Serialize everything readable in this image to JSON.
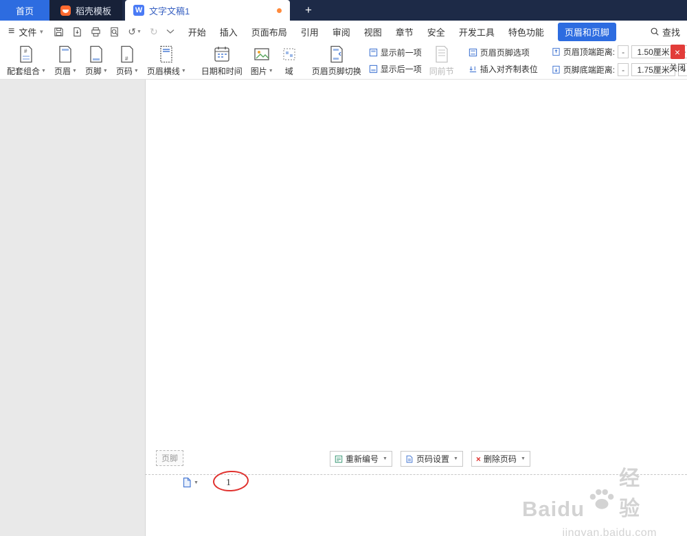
{
  "tabbar": {
    "home": "首页",
    "docer": "稻壳模板",
    "document": "文字文稿1",
    "new_tab": "+"
  },
  "menubar": {
    "file": "文件",
    "tabs": [
      "开始",
      "插入",
      "页面布局",
      "引用",
      "审阅",
      "视图",
      "章节",
      "安全",
      "开发工具",
      "特色功能"
    ],
    "active_tab": "页眉和页脚",
    "find": "查找"
  },
  "ribbon": {
    "combo": "配套组合",
    "header": "页眉",
    "footer": "页脚",
    "page_number": "页码",
    "header_line": "页眉横线",
    "datetime": "日期和时间",
    "picture": "图片",
    "field": "域",
    "switch_hf": "页眉页脚切换",
    "show_prev": "显示前一项",
    "show_next": "显示后一项",
    "same_section": "同前节",
    "hf_options": "页眉页脚选项",
    "insert_tab_stop": "插入对齐制表位",
    "header_top_label": "页眉顶端距离:",
    "header_top_value": "1.50厘米",
    "footer_bottom_label": "页脚底端距离:",
    "footer_bottom_value": "1.75厘米",
    "minus": "-",
    "plus": "+",
    "close": "关闭"
  },
  "footer_area": {
    "tag": "页脚",
    "renumber": "重新编号",
    "page_setup": "页码设置",
    "delete_number": "删除页码",
    "page_number": "1"
  },
  "watermark": {
    "brand": "Baidu",
    "suffix": "经验",
    "url": "jingyan.baidu.com"
  },
  "colors": {
    "accent": "#2d6ce0",
    "tabbar_bg": "#1d2a47",
    "close_red": "#e23c39",
    "annotation_red": "#e0312e",
    "docer_orange": "#ff6a30",
    "unsaved_orange": "#ff8a3c"
  }
}
